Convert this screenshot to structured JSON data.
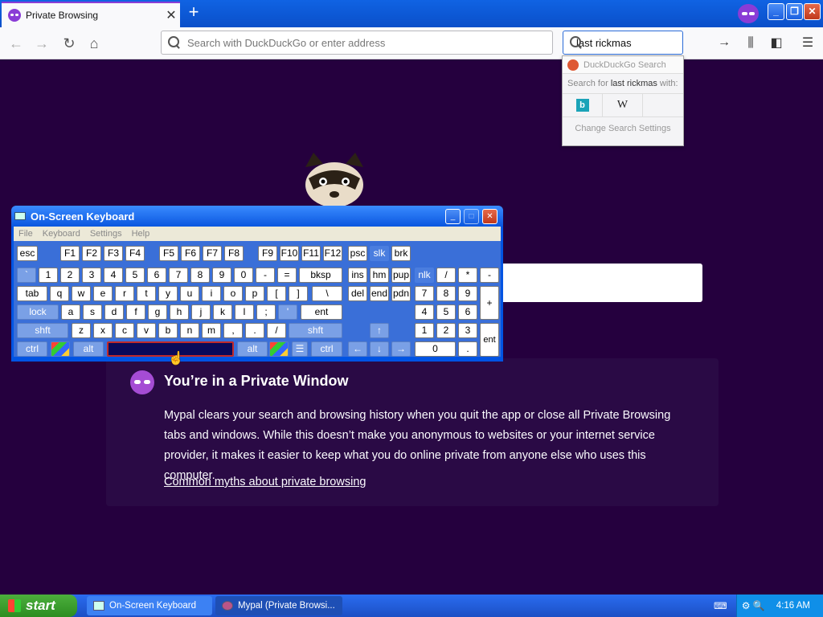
{
  "browser": {
    "tab_title": "Private Browsing",
    "tab_close": "✕",
    "new_tab": "+",
    "url_placeholder": "Search with DuckDuckGo or enter address",
    "search_value": "last rickmas",
    "window_buttons": [
      "_",
      "❐",
      "✕"
    ]
  },
  "search_popup": {
    "engine": "DuckDuckGo Search",
    "search_for_prefix": "Search for ",
    "search_for_query": "last rickmas",
    "search_for_suffix": " with:",
    "engines": [
      "b",
      "W"
    ],
    "change_settings": "Change Search Settings"
  },
  "page": {
    "title": "You’re in a Private Window",
    "body": "Mypal clears your search and browsing history when you quit the app or close all Private Browsing tabs and windows. While this doesn’t make you anonymous to websites or your internet service provider, it makes it easier to keep what you do online private from anyone else who uses this computer.",
    "link": "Common myths about private browsing"
  },
  "osk": {
    "title": "On-Screen Keyboard",
    "menu": [
      "File",
      "Keyboard",
      "Settings",
      "Help"
    ],
    "keys": {
      "esc": "esc",
      "f1": "F1",
      "f2": "F2",
      "f3": "F3",
      "f4": "F4",
      "f5": "F5",
      "f6": "F6",
      "f7": "F7",
      "f8": "F8",
      "f9": "F9",
      "f10": "F10",
      "f11": "F11",
      "f12": "F12",
      "psc": "psc",
      "slk": "slk",
      "brk": "brk",
      "grave": "`",
      "d1": "1",
      "d2": "2",
      "d3": "3",
      "d4": "4",
      "d5": "5",
      "d6": "6",
      "d7": "7",
      "d8": "8",
      "d9": "9",
      "d0": "0",
      "minus": "-",
      "equals": "=",
      "bksp": "bksp",
      "ins": "ins",
      "hm": "hm",
      "pup": "pup",
      "nlk": "nlk",
      "ndiv": "/",
      "nmul": "*",
      "nsub": "-",
      "tab": "tab",
      "q": "q",
      "w": "w",
      "e": "e",
      "r": "r",
      "t": "t",
      "y": "y",
      "u": "u",
      "i": "i",
      "o": "o",
      "p": "p",
      "lbr": "[",
      "rbr": "]",
      "bsl": "\\",
      "del": "del",
      "end": "end",
      "pdn": "pdn",
      "n7": "7",
      "n8": "8",
      "n9": "9",
      "nplus": "+",
      "lock": "lock",
      "a": "a",
      "s": "s",
      "d": "d",
      "f": "f",
      "g": "g",
      "h": "h",
      "j": "j",
      "k": "k",
      "l": "l",
      "semi": ";",
      "quote": "'",
      "ent": "ent",
      "n4": "4",
      "n5": "5",
      "n6": "6",
      "shft": "shft",
      "z": "z",
      "x": "x",
      "c": "c",
      "v": "v",
      "b": "b",
      "n": "n",
      "m": "m",
      "comma": ",",
      "period": ".",
      "slash": "/",
      "shft2": "shft",
      "up": "↑",
      "n1": "1",
      "n2": "2",
      "n3": "3",
      "nent": "ent",
      "ctrl": "ctrl",
      "alt": "alt",
      "alt2": "alt",
      "ctrl2": "ctrl",
      "left": "←",
      "down": "↓",
      "right": "→",
      "n0": "0",
      "ndot": "."
    }
  },
  "taskbar": {
    "start": "start",
    "tasks": [
      "On-Screen Keyboard",
      "Mypal (Private Browsi..."
    ],
    "clock": "4:16 AM"
  },
  "colors": {
    "page_bg": "#25003e",
    "accent": "#8a3cd6",
    "osk_frame": "#0054e3",
    "taskbar": "#2a6cf0"
  }
}
